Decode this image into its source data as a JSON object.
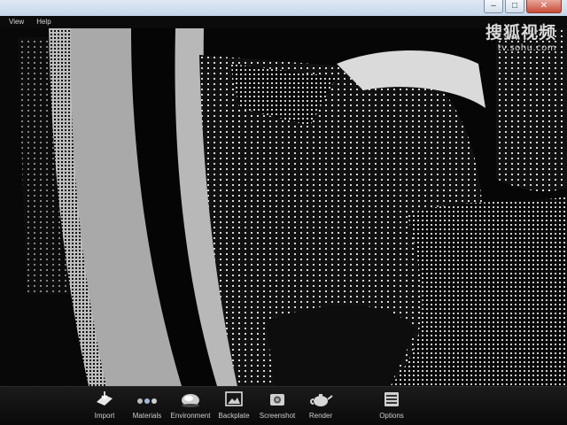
{
  "menu": {
    "view": "View",
    "help": "Help"
  },
  "window_controls": {
    "minimize": "–",
    "maximize": "□",
    "close": "✕"
  },
  "watermark": {
    "logo": "搜狐视频",
    "url": "tv.sohu.com"
  },
  "toolbar": {
    "import": "Import",
    "materials": "Materials",
    "environment": "Environment",
    "backplate": "Backplate",
    "screenshot": "Screenshot",
    "render": "Render",
    "options": "Options"
  },
  "colors": {
    "toolbar_bg": "#111111",
    "label": "#cfcfcf",
    "viewport_bg": "#060606"
  }
}
